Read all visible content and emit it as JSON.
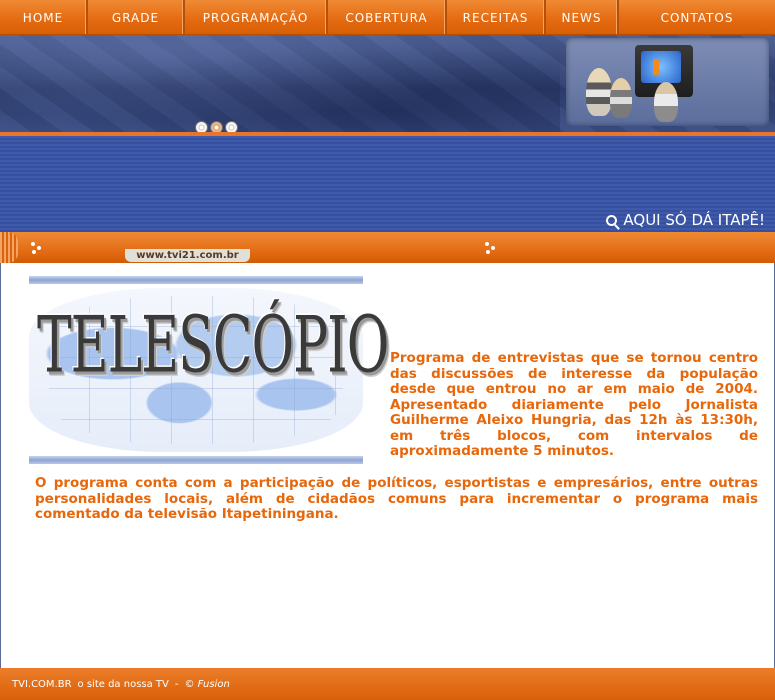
{
  "nav": {
    "items": [
      {
        "label": "HOME"
      },
      {
        "label": "GRADE"
      },
      {
        "label": "PROGRAMAÇÃO"
      },
      {
        "label": "COBERTURA"
      },
      {
        "label": "RECEITAS"
      },
      {
        "label": "NEWS"
      },
      {
        "label": "CONTATOS"
      }
    ]
  },
  "hero": {
    "slogan": "AQUI SÓ DÁ ITAPÊ!"
  },
  "subbar": {
    "site_url": "www.tvi21.com.br"
  },
  "program": {
    "logo_text": "TELESCÓPIO",
    "intro": "Programa de entrevistas que se tornou centro das discussões de interesse da população desde que entrou no ar em maio de 2004. Apresentado diariamente pelo Jornalista Guilherme Aleixo Hungria, das 12h às 13:30h, em três blocos, com intervalos de aproximadamente 5 minutos.",
    "body": "O programa conta com a participação de políticos, esportistas e empresários, entre outras personalidades locais, além de cidadãos comuns para incrementar o programa mais comentado da televisão Itapetiningana."
  },
  "footer": {
    "site": "TVI.COM.BR",
    "tagline": "o site da nossa TV",
    "separator": "-",
    "credit": "© Fusion"
  },
  "colors": {
    "accent_orange": "#e8670a",
    "nav_orange": "#e36a10",
    "band_blue": "#3f5aa8"
  }
}
